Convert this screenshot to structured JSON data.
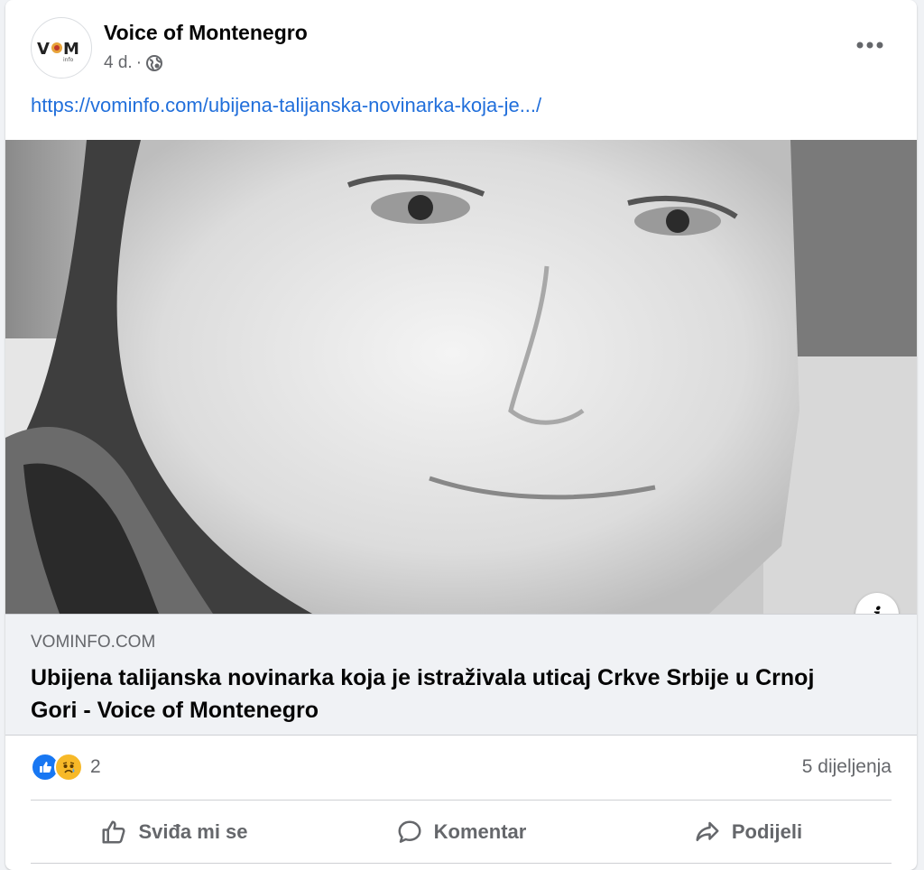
{
  "post": {
    "page_name": "Voice of Montenegro",
    "time": "4 d.",
    "separator": "·",
    "visibility_icon": "globe-icon",
    "avatar_logo_text": "VOM",
    "avatar_logo_sub": "info",
    "url_text": "https://vominfo.com/ubijena-talijanska-novinarka-koja-je.../"
  },
  "link_preview": {
    "domain": "VOMINFO.COM",
    "title": "Ubijena talijanska novinarka koja je istraživala uticaj Crkve Srbije u Crnoj Gori - Voice of Montenegro",
    "info_icon": "i"
  },
  "stats": {
    "reaction_icons": [
      "like-icon",
      "sad-icon"
    ],
    "reaction_count": "2",
    "shares": "5 dijeljenja"
  },
  "actions": {
    "like": "Sviđa mi se",
    "comment": "Komentar",
    "share": "Podijeli"
  },
  "colors": {
    "link": "#216fdb",
    "like_blue": "#1877f2",
    "sad_yellow": "#f7b928",
    "secondary_text": "#65676b"
  }
}
